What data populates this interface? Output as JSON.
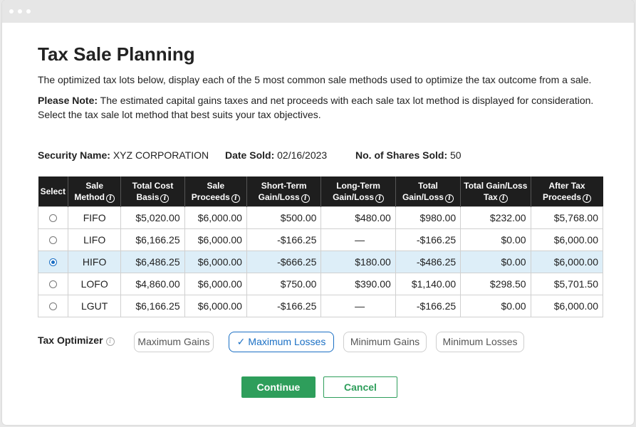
{
  "page": {
    "title": "Tax Sale Planning",
    "intro": "The optimized tax lots below, display each of the 5 most common sale methods used to optimize the tax outcome from a sale.",
    "note_label": "Please Note:",
    "note_text": " The estimated capital gains taxes and net proceeds with each sale tax lot method is displayed for consideration. Select the tax sale lot method that best suits your tax objectives."
  },
  "meta": {
    "security_label": "Security Name:",
    "security_value": "XYZ CORPORATION",
    "date_label": "Date Sold:",
    "date_value": "02/16/2023",
    "shares_label": "No. of Shares Sold:",
    "shares_value": "50"
  },
  "table": {
    "headers": [
      {
        "line1": "Select",
        "line2": "",
        "info": false
      },
      {
        "line1": "Sale",
        "line2": "Method",
        "info": true
      },
      {
        "line1": "Total Cost",
        "line2": "Basis",
        "info": true
      },
      {
        "line1": "Sale",
        "line2": "Proceeds",
        "info": true
      },
      {
        "line1": "Short-Term",
        "line2": "Gain/Loss",
        "info": true
      },
      {
        "line1": "Long-Term",
        "line2": "Gain/Loss",
        "info": true
      },
      {
        "line1": "Total",
        "line2": "Gain/Loss",
        "info": true
      },
      {
        "line1": "Total Gain/Loss",
        "line2": "Tax",
        "info": true
      },
      {
        "line1": "After Tax",
        "line2": "Proceeds",
        "info": true
      }
    ],
    "rows": [
      {
        "method": "FIFO",
        "cost_basis": "$5,020.00",
        "proceeds": "$6,000.00",
        "short_term": "$500.00",
        "long_term": "$480.00",
        "total": "$980.00",
        "tax": "$232.00",
        "after_tax": "$5,768.00",
        "selected": false
      },
      {
        "method": "LIFO",
        "cost_basis": "$6,166.25",
        "proceeds": "$6,000.00",
        "short_term": "-$166.25",
        "long_term": "—",
        "total": "-$166.25",
        "tax": "$0.00",
        "after_tax": "$6,000.00",
        "selected": false
      },
      {
        "method": "HIFO",
        "cost_basis": "$6,486.25",
        "proceeds": "$6,000.00",
        "short_term": "-$666.25",
        "long_term": "$180.00",
        "total": "-$486.25",
        "tax": "$0.00",
        "after_tax": "$6,000.00",
        "selected": true
      },
      {
        "method": "LOFO",
        "cost_basis": "$4,860.00",
        "proceeds": "$6,000.00",
        "short_term": "$750.00",
        "long_term": "$390.00",
        "total": "$1,140.00",
        "tax": "$298.50",
        "after_tax": "$5,701.50",
        "selected": false
      },
      {
        "method": "LGUT",
        "cost_basis": "$6,166.25",
        "proceeds": "$6,000.00",
        "short_term": "-$166.25",
        "long_term": "—",
        "total": "-$166.25",
        "tax": "$0.00",
        "after_tax": "$6,000.00",
        "selected": false
      }
    ]
  },
  "optimizer": {
    "label": "Tax Optimizer",
    "options": [
      "Maximum Gains",
      "Maximum Losses",
      "Minimum Gains",
      "Minimum Losses"
    ],
    "selected": "Maximum Losses",
    "check_glyph": "✓"
  },
  "actions": {
    "continue_label": "Continue",
    "cancel_label": "Cancel"
  },
  "icons": {
    "info": "info-circle-icon",
    "check": "checkmark-icon"
  },
  "colors": {
    "header_bg": "#1e1e1e",
    "selected_row_bg": "#ddeef8",
    "accent_blue": "#1a6fc4",
    "success_green": "#2e9e5b"
  }
}
